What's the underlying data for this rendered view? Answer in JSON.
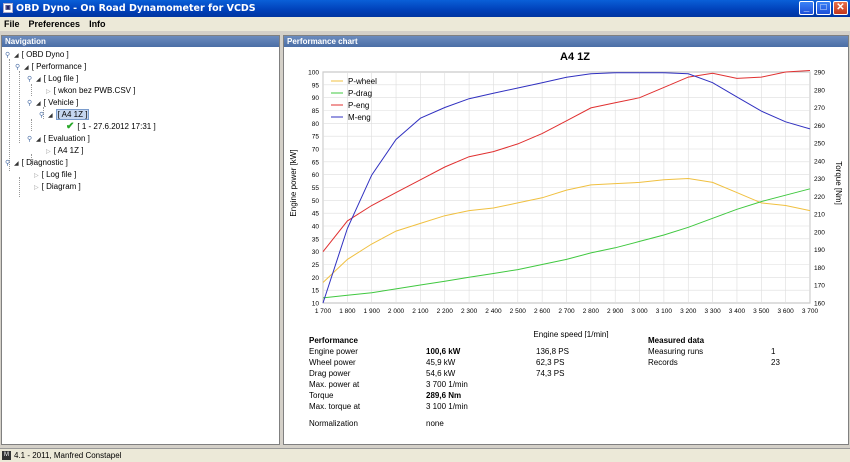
{
  "window": {
    "title": "OBD Dyno - On Road Dynamometer for VCDS",
    "icon": "app-icon"
  },
  "menu": [
    "File",
    "Preferences",
    "Info"
  ],
  "navigation": {
    "header": "Navigation",
    "tree": {
      "root": "[ OBD Dyno ]",
      "performance": "[ Performance ]",
      "log_file": "[ Log file ]",
      "log_file_item": "[ wkon bez PWB.CSV ]",
      "vehicle": "[ Vehicle ]",
      "vehicle_item": "[ A4 1Z ]",
      "run_item": "[ 1 - 27.6.2012 17:31 ]",
      "evaluation": "[ Evaluation ]",
      "evaluation_item": "[ A4 1Z ]",
      "diagnostic": "[ Diagnostic ]",
      "diag_log_file": "[ Log file ]",
      "diag_diagram": "[ Diagram ]"
    }
  },
  "chart_panel": {
    "header": "Performance chart"
  },
  "chart_data": {
    "type": "line",
    "title": "A4 1Z",
    "xlabel": "Engine speed [1/min]",
    "ylabel": "Engine power [kW]",
    "y2label": "Torque [Nm]",
    "x": [
      1700,
      1800,
      1900,
      2000,
      2100,
      2200,
      2300,
      2400,
      2500,
      2600,
      2700,
      2800,
      2900,
      3000,
      3100,
      3200,
      3300,
      3400,
      3500,
      3600,
      3700
    ],
    "xlim": [
      1700,
      3700
    ],
    "ylim": [
      10,
      100
    ],
    "y2lim": [
      160,
      290
    ],
    "xticks": [
      "1 700",
      "1 800",
      "1 900",
      "2 000",
      "2 100",
      "2 200",
      "2 300",
      "2 400",
      "2 500",
      "2 600",
      "2 700",
      "2 800",
      "2 900",
      "3 000",
      "3 100",
      "3 200",
      "3 300",
      "3 400",
      "3 500",
      "3 600",
      "3 700"
    ],
    "yticks": [
      "10",
      "15",
      "20",
      "25",
      "30",
      "35",
      "40",
      "45",
      "50",
      "55",
      "60",
      "65",
      "70",
      "75",
      "80",
      "85",
      "90",
      "95",
      "100"
    ],
    "y2ticks": [
      "160",
      "170",
      "180",
      "190",
      "200",
      "210",
      "220",
      "230",
      "240",
      "250",
      "260",
      "270",
      "280",
      "290"
    ],
    "grid": true,
    "legend_position": "top-left",
    "series": [
      {
        "name": "P-wheel",
        "color": "#f0c040",
        "axis": "left",
        "values": [
          18,
          27,
          33,
          38,
          41,
          44,
          46,
          47,
          49,
          51,
          54,
          56,
          56.5,
          57,
          58,
          58.5,
          57,
          53,
          49,
          48,
          46
        ]
      },
      {
        "name": "P-drag",
        "color": "#40c840",
        "axis": "left",
        "values": [
          12,
          13,
          14,
          15.5,
          17,
          18.5,
          20,
          21.5,
          23,
          25,
          27,
          29.5,
          31.5,
          34,
          36.5,
          39.5,
          43,
          46.5,
          49.5,
          52,
          54.5
        ]
      },
      {
        "name": "P-eng",
        "color": "#e03030",
        "axis": "left",
        "values": [
          30,
          42,
          48,
          53,
          58,
          63,
          67,
          69,
          72,
          76,
          81,
          86,
          88,
          90,
          94,
          98,
          99.5,
          97.5,
          98,
          100,
          100.6
        ]
      },
      {
        "name": "M-eng",
        "color": "#3030c0",
        "axis": "right",
        "values": [
          160,
          202,
          232,
          252,
          264,
          270,
          275,
          278,
          281,
          284,
          287,
          289,
          289.6,
          289.6,
          289.6,
          289,
          284,
          276,
          268,
          262,
          258
        ]
      }
    ]
  },
  "performance": {
    "heading": "Performance",
    "rows": [
      {
        "label": "Engine power",
        "value": "100,6 kW",
        "ps": "136,8 PS",
        "bold": true
      },
      {
        "label": "Wheel power",
        "value": "45,9 kW",
        "ps": "62,3 PS",
        "bold": false
      },
      {
        "label": "Drag power",
        "value": "54,6 kW",
        "ps": "74,3 PS",
        "bold": false
      },
      {
        "label": "Max. power at",
        "value": "3 700 1/min",
        "ps": "",
        "bold": false
      },
      {
        "label": "Torque",
        "value": "289,6 Nm",
        "ps": "",
        "bold": true
      },
      {
        "label": "Max. torque at",
        "value": "3 100 1/min",
        "ps": "",
        "bold": false
      }
    ],
    "normalization_label": "Normalization",
    "normalization_value": "none"
  },
  "measured": {
    "heading": "Measured data",
    "rows": [
      {
        "label": "Measuring runs",
        "value": "1"
      },
      {
        "label": "Records",
        "value": "23"
      }
    ]
  },
  "status": {
    "text": "4.1 - 2011, Manfred Constapel"
  }
}
